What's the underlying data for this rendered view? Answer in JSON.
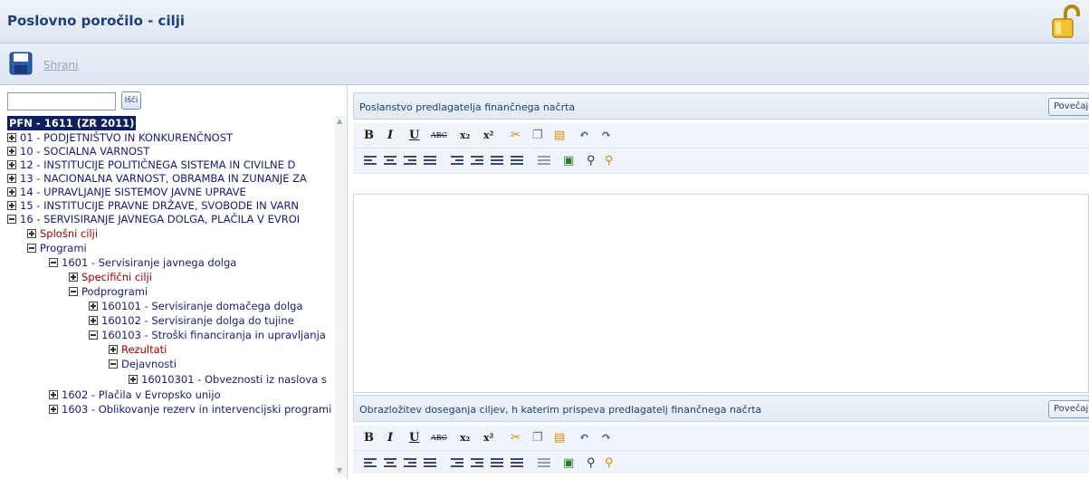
{
  "window": {
    "title": "Poslovno poročilo - cilji"
  },
  "toolbar": {
    "save_label": "Shrani"
  },
  "search": {
    "button": "Išči",
    "value": ""
  },
  "tree": {
    "root": "PFN - 1611 (ZR 2011)",
    "items": [
      "01 - PODJETNIŠTVO IN KONKURENČNOST",
      "10 - SOCIALNA VARNOST",
      "12 - INSTITUCIJE POLITIČNEGA SISTEMA IN CIVILNE D",
      "13 - NACIONALNA VARNOST, OBRAMBA IN ZUNANJE ZA",
      "14 - UPRAVLJANJE SISTEMOV JAVNE UPRAVE",
      "15 - INSTITUCIJE PRAVNE DRŽAVE, SVOBODE IN VARN",
      "16 - SERVISIRANJE JAVNEGA DOLGA, PLAČILA V EVROI",
      "Splošni cilji",
      "Programi",
      "1601 - Servisiranje javnega dolga",
      "Specifični cilji",
      "Podprogrami",
      "160101 - Servisiranje domačega dolga",
      "160102 - Servisiranje dolga do tujine",
      "160103 - Stroški financiranja in upravljanja ",
      "Rezultati",
      "Dejavnosti",
      "16010301 - Obveznosti iz naslova s",
      "1602 - Plačila v Evropsko unijo",
      "1603 - Oblikovanje rezerv in intervencijski programi"
    ]
  },
  "sections": [
    {
      "title": "Poslanstvo predlagatelja finančnega načrta",
      "enlarge": "Povečaj"
    },
    {
      "title": "Obrazložitev doseganja ciljev, h katerim prispeva predlagatelj finančnega načrta",
      "enlarge": "Povečaj"
    }
  ],
  "editor_toolbar": {
    "bold": "B",
    "italic": "I",
    "underline": "U",
    "strike": "ABC",
    "subscript": "x₂",
    "superscript": "x²"
  },
  "colors": {
    "title": "#1f3e7c",
    "red_node": "#a00000",
    "root_bg": "#0d1f5e"
  }
}
